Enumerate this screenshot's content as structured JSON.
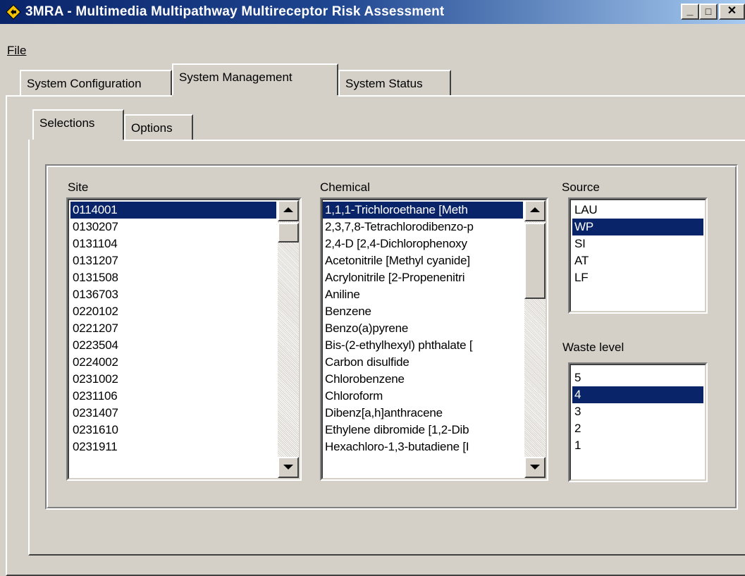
{
  "window": {
    "title": "3MRA - Multimedia Multipathway Multireceptor Risk Assessment",
    "controls": {
      "minimize": "_",
      "maximize": "□",
      "close": "✕"
    }
  },
  "menu": {
    "file": "File"
  },
  "tabs": [
    {
      "label": "System Configuration",
      "active": false
    },
    {
      "label": "System Management",
      "active": true
    },
    {
      "label": "System Status",
      "active": false
    }
  ],
  "subtabs": [
    {
      "label": "Selections",
      "active": true
    },
    {
      "label": "Options",
      "active": false
    }
  ],
  "site": {
    "label": "Site",
    "items": [
      "0114001",
      "0130207",
      "0131104",
      "0131207",
      "0131508",
      "0136703",
      "0220102",
      "0221207",
      "0223504",
      "0224002",
      "0231002",
      "0231106",
      "0231407",
      "0231610",
      "0231911"
    ],
    "selected_index": 0
  },
  "chemical": {
    "label": "Chemical",
    "items": [
      " 1,1,1-Trichloroethane  [Meth",
      " 2,3,7,8-Tetrachlorodibenzo-p",
      " 2,4-D  [2,4-Dichlorophenoxy",
      "Acetonitrile  [Methyl cyanide]",
      "Acrylonitrile   [2-Propenenitri",
      "Aniline",
      "Benzene",
      "Benzo(a)pyrene",
      "Bis-(2-ethylhexyl) phthalate  [",
      "Carbon disulfide",
      "Chlorobenzene",
      "Chloroform",
      " Dibenz[a,h]anthracene",
      " Ethylene dibromide  [1,2-Dib",
      " Hexachloro-1,3-butadiene  [I"
    ],
    "selected_index": 0
  },
  "source": {
    "label": "Source",
    "items": [
      "LAU",
      "WP",
      "SI",
      "AT",
      "LF"
    ],
    "selected_index": 1
  },
  "waste_level": {
    "label": "Waste level",
    "items": [
      "5",
      "4",
      "3",
      "2",
      "1"
    ],
    "selected_index": 1
  },
  "colors": {
    "selection": "#0a246a",
    "face": "#d4d0c8"
  }
}
